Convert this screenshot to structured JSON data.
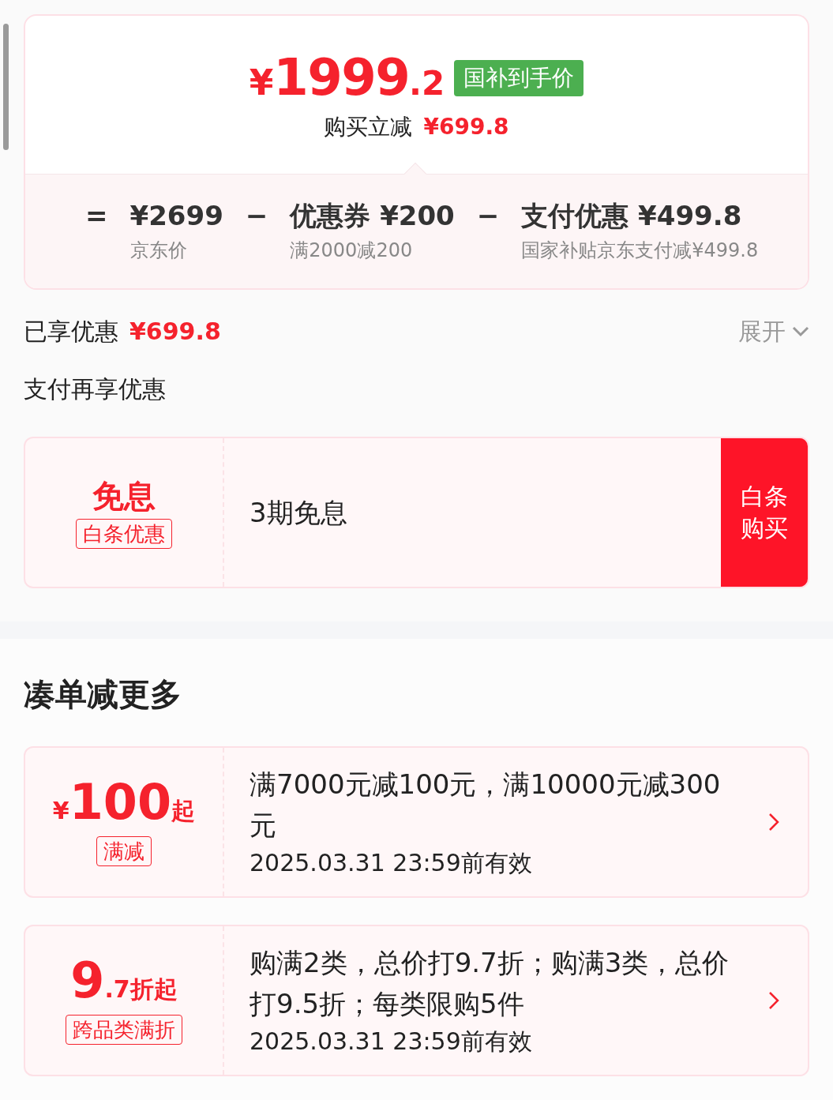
{
  "price_card": {
    "currency": "¥",
    "price_integer": "1999",
    "price_decimal": ".2",
    "badge": "国补到手价",
    "instant_label": "购买立减",
    "instant_value": "¥699.8",
    "breakdown": [
      {
        "operator": "=",
        "value": "¥2699",
        "caption": "京东价"
      },
      {
        "operator": "−",
        "value": "优惠券 ¥200",
        "caption": "满2000减200"
      },
      {
        "operator": "−",
        "value": "支付优惠 ¥499.8",
        "caption": "国家补贴京东支付减¥499.8"
      }
    ]
  },
  "savings": {
    "label": "已享优惠",
    "value": "¥699.8",
    "toggle": "展开",
    "expanded": false
  },
  "pay_section": {
    "title": "支付再享优惠",
    "offer": {
      "title": "免息",
      "tag": "白条优惠",
      "description": "3期免息",
      "button": "白条购买"
    }
  },
  "promo_section": {
    "title": "凑单减更多",
    "promos": [
      {
        "kind": "amount",
        "currency": "¥",
        "value": "100",
        "suffix": "起",
        "tag": "满减",
        "description": "满7000元减100元，满10000元减300元",
        "validity": "2025.03.31 23:59前有效"
      },
      {
        "kind": "discount",
        "value": "9",
        "suffix": ".7折起",
        "tag": "跨品类满折",
        "description": "购满2类，总价打9.7折；购满3类，总价打9.5折；每类限购5件",
        "validity": "2025.03.31 23:59前有效"
      }
    ]
  }
}
